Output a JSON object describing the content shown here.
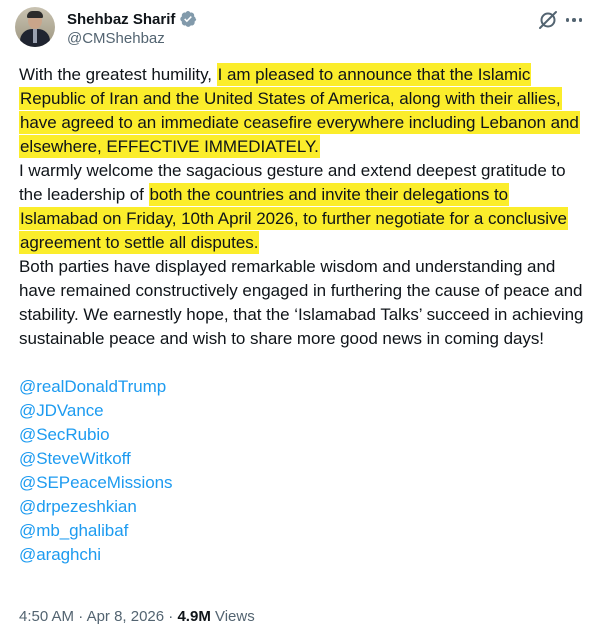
{
  "author": {
    "display_name": "Shehbaz Sharif",
    "handle": "@CMShehbaz",
    "verified_color": "#829aab"
  },
  "header_icons": [
    "grok-icon",
    "more-icon"
  ],
  "body": {
    "p1_plain": "With the greatest humility, ",
    "p1_highlight": "I am pleased to announce that the Islamic Republic of Iran and the United States of America, along with their allies, have agreed to an immediate ceasefire everywhere including Lebanon and elsewhere, EFFECTIVE IMMEDIATELY.",
    "p2_plain": "I warmly welcome the sagacious gesture and extend deepest gratitude to the leadership of ",
    "p2_highlight": "both the countries and invite their delegations to Islamabad on Friday, 10th April 2026, to further negotiate for a conclusive agreement to settle all disputes.",
    "p3": "Both parties have displayed remarkable wisdom and understanding and have remained constructively engaged in furthering the cause of peace and stability. We earnestly hope, that the ‘Islamabad Talks’ succeed in achieving sustainable peace and wish to share more good news in coming days!",
    "mentions": [
      "@realDonaldTrump",
      "@JDVance",
      "@SecRubio",
      "@SteveWitkoff",
      "@SEPeaceMissions",
      "@drpezeshkian",
      "@mb_ghalibaf",
      "@araghchi"
    ]
  },
  "meta": {
    "time": "4:50 AM",
    "date": "Apr 8, 2026",
    "separator": " · ",
    "views_count": "4.9M",
    "views_label": " Views"
  },
  "colors": {
    "highlight": "#fbed2b",
    "link": "#1d9bf0",
    "secondary_text": "#536471"
  }
}
